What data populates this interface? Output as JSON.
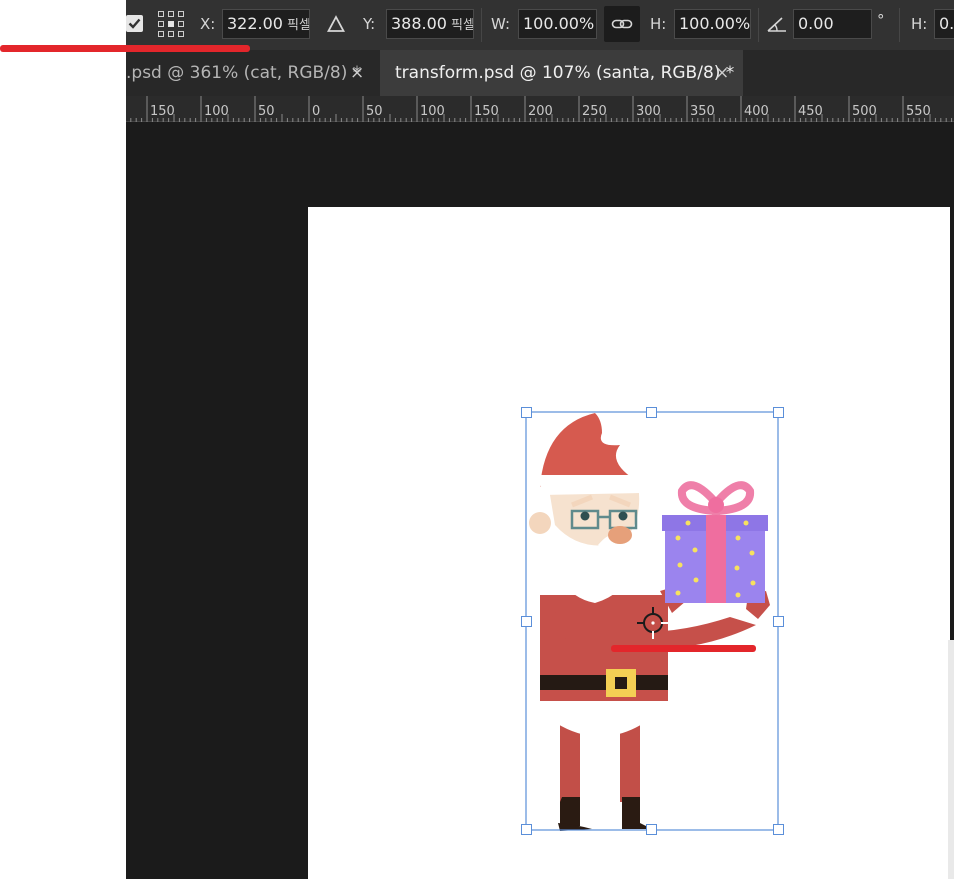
{
  "options_bar": {
    "x_label": "X:",
    "x_value": "322.00",
    "x_unit": "픽셀",
    "y_label": "Y:",
    "y_value": "388.00",
    "y_unit": "픽셀",
    "w_label": "W:",
    "w_value": "100.00%",
    "h_label": "H:",
    "h_value": "100.00%",
    "angle_value": "0.00",
    "angle_unit": "°",
    "h_skew_label": "H:",
    "h_skew_value": "0."
  },
  "tabs": [
    {
      "title": ".psd @ 361% (cat, RGB/8) *",
      "close": "×",
      "active": false
    },
    {
      "title": "transform.psd @ 107% (santa, RGB/8) *",
      "close": "×",
      "active": true
    }
  ],
  "ruler": {
    "labels": [
      "150",
      "100",
      "50",
      "0",
      "50",
      "100",
      "150",
      "200",
      "250",
      "300",
      "350",
      "400",
      "450",
      "500",
      "550"
    ]
  },
  "colors": {
    "annotation": "#e3262b",
    "selection": "#5b8fd9",
    "canvas": "#ffffff",
    "workspace": "#1b1b1b"
  },
  "icons": {
    "checkbox": "checkmark-icon",
    "reference_point": "reference-point-icon",
    "delta": "delta-icon",
    "link": "link-icon",
    "angle": "angle-icon",
    "tab_close": "close-icon",
    "pivot": "crosshair-icon"
  },
  "layer": {
    "name": "santa"
  }
}
